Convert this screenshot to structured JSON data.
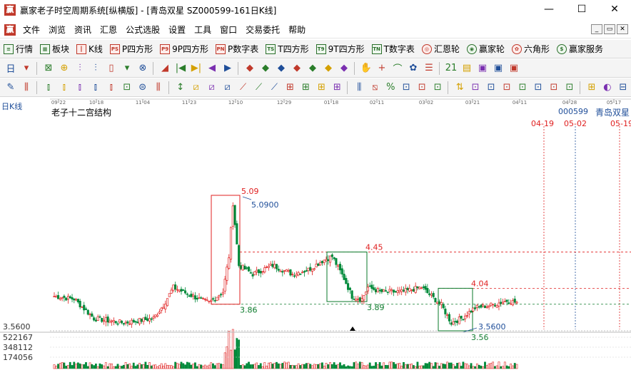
{
  "window": {
    "title": "赢家老子时空周期系统[纵横版] - [青岛双星  SZ000599-161日K线]",
    "app_icon": "赢",
    "minimize": "—",
    "maximize": "☐",
    "close": "✕"
  },
  "menu": {
    "logo": "赢",
    "items": [
      "文件",
      "浏览",
      "资讯",
      "汇恩",
      "公式选股",
      "设置",
      "工具",
      "窗口",
      "交易委托",
      "帮助"
    ],
    "mdi_buttons": [
      "_",
      "▭",
      "✕"
    ]
  },
  "nav": {
    "items": [
      {
        "label": "行情",
        "icon": "grid-icon",
        "glyph": "≡"
      },
      {
        "label": "板块",
        "icon": "blocks-icon",
        "glyph": "▦"
      },
      {
        "label": "K线",
        "icon": "candlestick-icon",
        "glyph": "┃"
      },
      {
        "label": "P四方形",
        "icon": "p-square-icon",
        "glyph": "PS"
      },
      {
        "label": "9P四方形",
        "icon": "9p-square-icon",
        "glyph": "P9"
      },
      {
        "label": "P数字表",
        "icon": "p-number-table-icon",
        "glyph": "PN"
      },
      {
        "label": "T四方形",
        "icon": "t-square-icon",
        "glyph": "TS"
      },
      {
        "label": "9T四方形",
        "icon": "9t-square-icon",
        "glyph": "T9"
      },
      {
        "label": "T数字表",
        "icon": "t-number-table-icon",
        "glyph": "TN"
      },
      {
        "label": "汇恩轮",
        "icon": "huien-wheel-icon",
        "glyph": "◎"
      },
      {
        "label": "赢家轮",
        "icon": "yingjia-wheel-icon",
        "glyph": "◉"
      },
      {
        "label": "六角形",
        "icon": "hexagon-icon",
        "glyph": "✿"
      },
      {
        "label": "赢家服务",
        "icon": "dollar-icon",
        "glyph": "$"
      }
    ]
  },
  "toolbar1": [
    "日",
    "▾",
    "⊠",
    "⊕",
    "⫶",
    "⫶",
    "▯",
    "▾",
    "⊗",
    "◢",
    "|◀",
    "▶|",
    "◀",
    "▶",
    "◆",
    "◆",
    "◆",
    "◆",
    "◆",
    "◆",
    "◆",
    "✋",
    "+",
    "⌒",
    "✿",
    "☰",
    "21",
    "▤",
    "▣",
    "▣",
    "▣"
  ],
  "toolbar2": [
    "✎",
    "⫼",
    "⫾",
    "⫾",
    "⫾",
    "⫾",
    "⫾",
    "⊡",
    "⊜",
    "⫼",
    "↕",
    "⧄",
    "⧄",
    "⧄",
    "⟋",
    "⟋",
    "⟋",
    "⊞",
    "⊞",
    "⊞",
    "⊞",
    "⫼",
    "⧅",
    "%",
    "⊡",
    "⊡",
    "⊡",
    "⇅",
    "⊡",
    "⊡",
    "⊡",
    "⊡",
    "⊡",
    "⊡",
    "⊡",
    "⊞",
    "◐",
    "⊟"
  ],
  "chart": {
    "period_label": "日K线",
    "title": "老子十二宫结构",
    "stock_code": "000599",
    "stock_name": "青岛双星",
    "date_ticks": [
      "09-22",
      "10-18",
      "11-04",
      "11-23",
      "12-10",
      "12-29",
      "01-18",
      "02-11",
      "03-02",
      "03-21",
      "04-11",
      "04-28",
      "05-17"
    ],
    "future_dates": [
      "04-19",
      "05-02",
      "05-19"
    ],
    "y_axis_low": "3.5600",
    "volume_ticks": [
      "522167",
      "348112",
      "174056"
    ],
    "annotations": {
      "high_509": "5.09",
      "high_50900": "5.0900",
      "level_445": "4.45",
      "level_404": "4.04",
      "level_386": "3.86",
      "level_389": "3.89",
      "low_35600": "3.5600",
      "low_356": "3.56"
    }
  },
  "colors": {
    "up": "#e02020",
    "down": "#008a3a",
    "box_red": "#e02020",
    "box_green": "#0a7a2a",
    "label_blue": "#1f4e99",
    "label_red": "#e02020",
    "label_green": "#0a7a2a"
  }
}
